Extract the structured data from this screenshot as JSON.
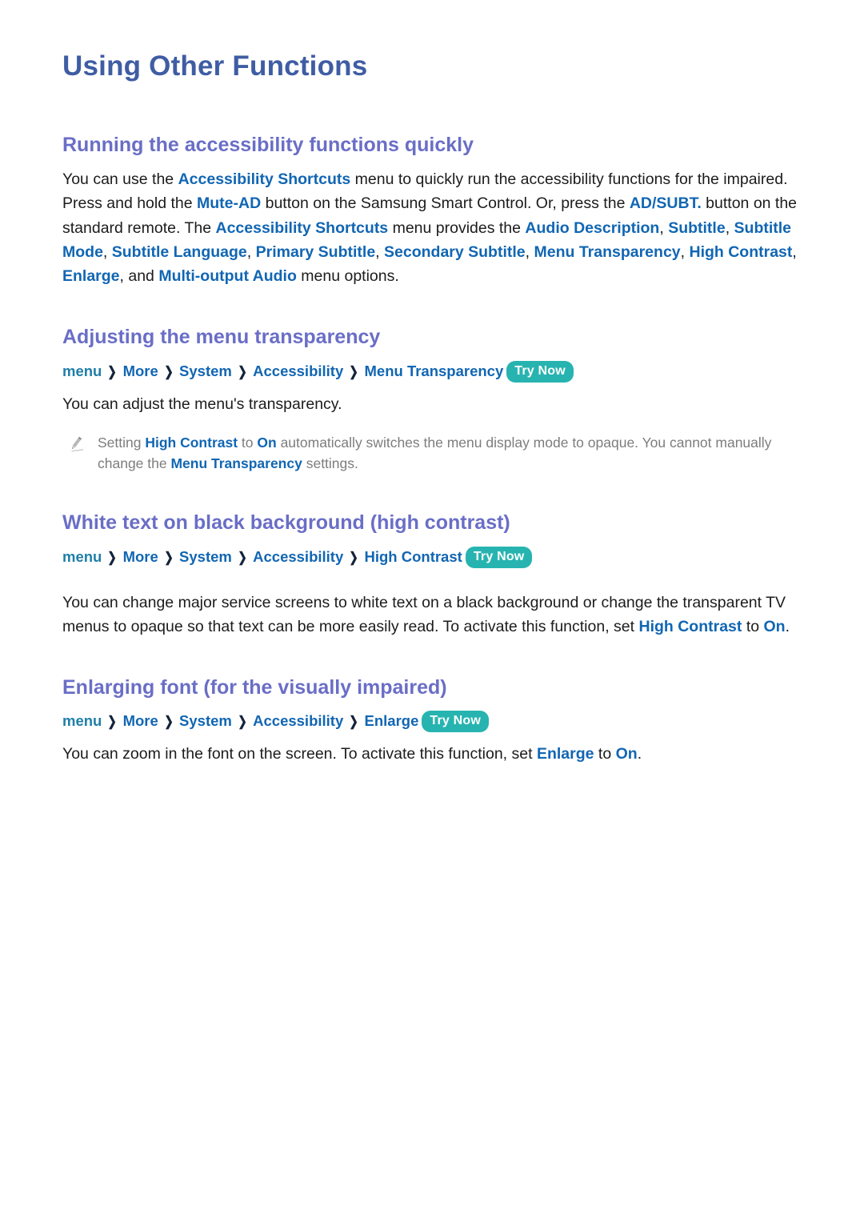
{
  "document": {
    "title": "Using Other Functions"
  },
  "sections": [
    {
      "id": "running-accessibility-quickly",
      "heading": "Running the accessibility functions quickly",
      "paragraph": {
        "t1": "You can use the ",
        "h1": "Accessibility Shortcuts",
        "t2": " menu to quickly run the accessibility functions for the impaired. Press and hold the ",
        "h2": "Mute-AD",
        "t3": " button on the Samsung Smart Control. Or, press the ",
        "h3": "AD/SUBT.",
        "t4": " button on the standard remote. The ",
        "h4": "Accessibility Shortcuts",
        "t5": " menu provides the ",
        "h5": "Audio Description",
        "t6": ", ",
        "h6": "Subtitle",
        "t7": ", ",
        "h7": "Subtitle Mode",
        "t8": ", ",
        "h8": "Subtitle Language",
        "t9": ", ",
        "h9": "Primary Subtitle",
        "t10": ", ",
        "h10": "Secondary Subtitle",
        "t11": ", ",
        "h11": "Menu Transparency",
        "t12": ", ",
        "h12": "High Contrast",
        "t13": ", ",
        "h13": "Enlarge",
        "t14": ", and ",
        "h14": "Multi-output Audio",
        "t15": " menu options."
      }
    },
    {
      "id": "adjusting-menu-transparency",
      "heading": "Adjusting the menu transparency",
      "breadcrumb": {
        "first": "menu",
        "items": [
          "More",
          "System",
          "Accessibility",
          "Menu Transparency"
        ],
        "separator": "❯",
        "badge": "Try Now"
      },
      "paragraph": "You can adjust the menu's transparency.",
      "note": {
        "icon": "pencil-icon",
        "t1": "Setting ",
        "h1": "High Contrast",
        "t2": " to ",
        "h2": "On",
        "t3": " automatically switches the menu display mode to opaque. You cannot manually change the ",
        "h3": "Menu Transparency",
        "t4": " settings."
      }
    },
    {
      "id": "white-text-black-background",
      "heading": "White text on black background (high contrast)",
      "breadcrumb": {
        "first": "menu",
        "items": [
          "More",
          "System",
          "Accessibility",
          "High Contrast"
        ],
        "separator": "❯",
        "badge": "Try Now"
      },
      "paragraph": {
        "t1": "You can change major service screens to white text on a black background or change the transparent TV menus to opaque so that text can be more easily read. To activate this function, set ",
        "h1": "High Contrast",
        "t2": " to ",
        "h2": "On",
        "t3": "."
      }
    },
    {
      "id": "enlarging-font",
      "heading": "Enlarging font (for the visually impaired)",
      "breadcrumb": {
        "first": "menu",
        "items": [
          "More",
          "System",
          "Accessibility",
          "Enlarge"
        ],
        "separator": "❯",
        "badge": "Try Now"
      },
      "paragraph": {
        "t1": "You can zoom in the font on the screen. To activate this function, set ",
        "h1": "Enlarge",
        "t2": " to ",
        "h2": "On",
        "t3": "."
      }
    }
  ],
  "colors": {
    "page_title": "#3f5da3",
    "section_heading": "#6a6ec6",
    "highlight": "#1166b3",
    "breadcrumb_first": "#1f7fa8",
    "badge_background": "#27b4b0",
    "badge_text": "#ffffff",
    "body_text": "#1c1c1c",
    "note_text": "#7d7d7d",
    "background": "#ffffff"
  }
}
